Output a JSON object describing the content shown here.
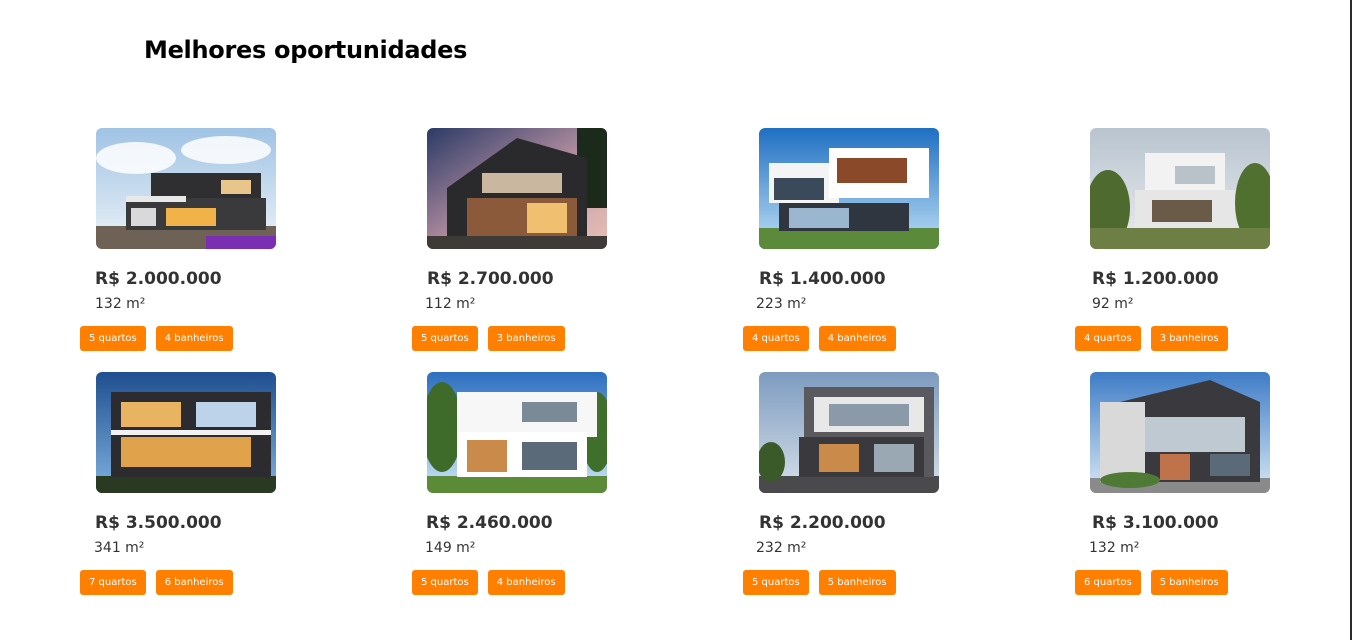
{
  "section": {
    "title": "Melhores oportunidades"
  },
  "colors": {
    "accent": "#ff7f00",
    "text": "#333333",
    "title": "#000000"
  },
  "listings": [
    {
      "price": "R$ 2.000.000",
      "area": "132 m²",
      "rooms": "5 quartos",
      "baths": "4 banheiros",
      "image": "modern-house-photo-1"
    },
    {
      "price": "R$ 2.700.000",
      "area": "112 m²",
      "rooms": "5 quartos",
      "baths": "3 banheiros",
      "image": "modern-house-photo-2"
    },
    {
      "price": "R$ 1.400.000",
      "area": "223 m²",
      "rooms": "4 quartos",
      "baths": "4 banheiros",
      "image": "modern-house-photo-3"
    },
    {
      "price": "R$ 1.200.000",
      "area": "92 m²",
      "rooms": "4 quartos",
      "baths": "3 banheiros",
      "image": "modern-house-photo-4"
    },
    {
      "price": "R$ 3.500.000",
      "area": "341 m²",
      "rooms": "7 quartos",
      "baths": "6 banheiros",
      "image": "modern-house-photo-5"
    },
    {
      "price": "R$ 2.460.000",
      "area": "149 m²",
      "rooms": "5 quartos",
      "baths": "4 banheiros",
      "image": "modern-house-photo-6"
    },
    {
      "price": "R$ 2.200.000",
      "area": "232 m²",
      "rooms": "5 quartos",
      "baths": "5 banheiros",
      "image": "modern-house-photo-7"
    },
    {
      "price": "R$ 3.100.000",
      "area": "132 m²",
      "rooms": "6 quartos",
      "baths": "5 banheiros",
      "image": "modern-house-photo-8"
    }
  ]
}
